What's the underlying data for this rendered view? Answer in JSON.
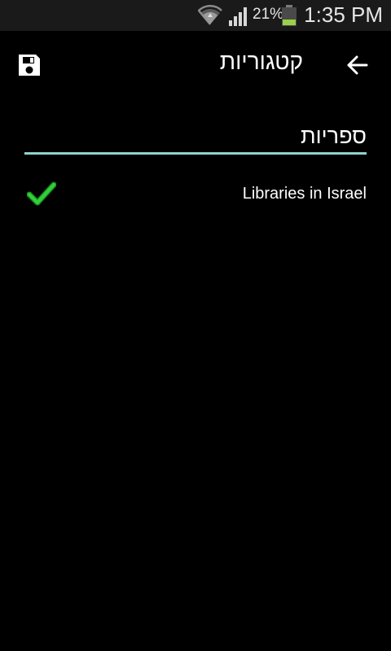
{
  "status_bar": {
    "battery_percent": "21%",
    "time": "1:35 PM"
  },
  "app_bar": {
    "title": "קטגוריות",
    "save_icon": "save-icon",
    "back_icon": "arrow-right-icon"
  },
  "section": {
    "title": "ספריות"
  },
  "items": [
    {
      "label": "Libraries in Israel",
      "checked": true
    }
  ],
  "colors": {
    "background": "#000000",
    "status_bar": "#1a1a1a",
    "divider": "#8fd3cf",
    "check": "#22c02a"
  }
}
